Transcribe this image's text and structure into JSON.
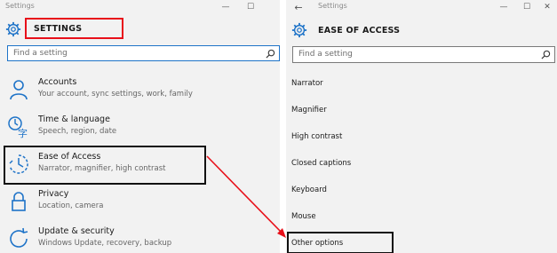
{
  "left": {
    "window_title": "Settings",
    "controls": {
      "minimize": "—",
      "maximize": "☐"
    },
    "header_title": "SETTINGS",
    "search_placeholder": "Find a setting",
    "categories": [
      {
        "icon": "person-icon",
        "title": "Accounts",
        "subtitle": "Your account, sync settings, work, family"
      },
      {
        "icon": "time-language-icon",
        "title": "Time & language",
        "subtitle": "Speech, region, date"
      },
      {
        "icon": "ease-of-access-icon",
        "title": "Ease of Access",
        "subtitle": "Narrator, magnifier, high contrast"
      },
      {
        "icon": "lock-icon",
        "title": "Privacy",
        "subtitle": "Location, camera"
      },
      {
        "icon": "sync-icon",
        "title": "Update & security",
        "subtitle": "Windows Update, recovery, backup"
      }
    ]
  },
  "right": {
    "back_arrow": "←",
    "window_title": "Settings",
    "controls": {
      "minimize": "—",
      "maximize": "☐",
      "close": "✕"
    },
    "header_title": "EASE OF ACCESS",
    "search_placeholder": "Find a setting",
    "items": [
      "Narrator",
      "Magnifier",
      "High contrast",
      "Closed captions",
      "Keyboard",
      "Mouse",
      "Other options"
    ]
  },
  "colors": {
    "highlight_red": "#e8101a",
    "accent_blue": "#1e73c8",
    "panel_bg": "#f2f2f2"
  }
}
